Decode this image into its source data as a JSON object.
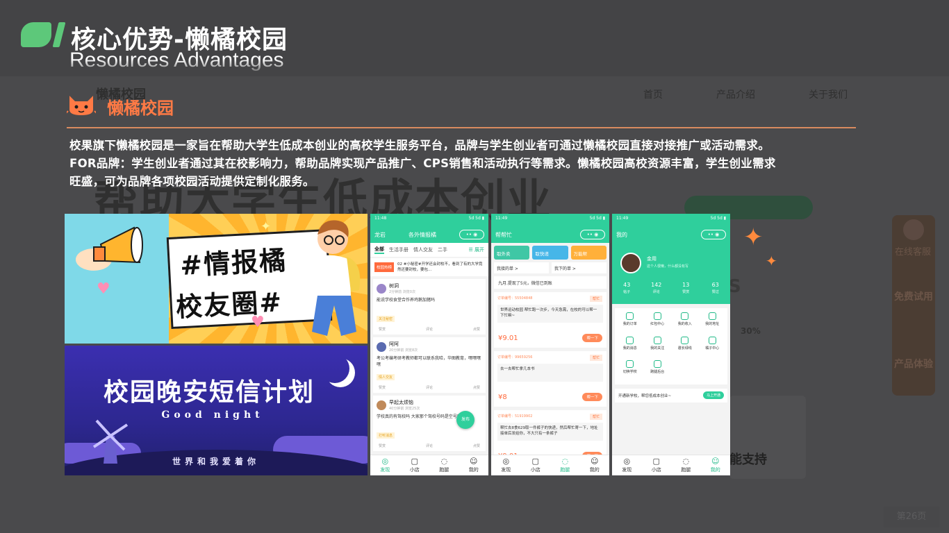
{
  "header": {
    "title_cn": "核心优势-懒橘校园",
    "title_en": "Resources Advantages"
  },
  "background_site": {
    "logo": "懒橘校园",
    "nav": [
      "首页",
      "产品介绍",
      "关于我们"
    ],
    "headline": "帮助大学生低成本创业",
    "side_service": "在线客服",
    "side_items": [
      "免费试用",
      "产品体验"
    ],
    "support_text": "能支持",
    "percent": "30%",
    "letter": "S"
  },
  "brand": {
    "name": "懒橘校园"
  },
  "intro": {
    "line1": "校果旗下懒橘校园是一家旨在帮助大学生低成本创业的高校学生服务平台，品牌与学生创业者可通过懒橘校园直接对接推广或活动需求。",
    "line2": "FOR品牌：学生创业者通过其在校影响力，帮助品牌实现产品推广、CPS销售和活动执行等需求。懒橘校园高校资源丰富，学生创业需求",
    "line3": "旺盛，可为品牌各项校园活动提供定制化服务。"
  },
  "banner1": {
    "line1": "#情报橘",
    "line2": "校友圈#"
  },
  "banner2": {
    "title": "校园晚安短信计划",
    "subtitle": "Good  night",
    "bottom": "世界和我爱着你"
  },
  "phone_feed": {
    "time": "11:48",
    "signal": "5d 5d ▮",
    "location": "龙岩",
    "title": "各外情报橘",
    "tabs": [
      "全部",
      "生活手册",
      "情人交友",
      "二手"
    ],
    "expand": "☰ 展开",
    "news_tag": "校园热榜",
    "news_text": "02 #小秘密#开学还会封校不，看到了有的大学竟然还要封校，要包...",
    "posts": [
      {
        "name": "树洞",
        "sub": "2分钟前  浏览0次",
        "body": "能说学校食堂合作养鸡鹅加猪吗",
        "chip": "关注秘密",
        "acts": [
          "赞赏",
          "评论",
          "点赞"
        ]
      },
      {
        "name": "阿阿",
        "sub": "20分钟前  浏览8次",
        "body": "考公考编考研考教师都可以联系我哈，华图教育，嘿嘿嘿嘿",
        "chip": "情人交友",
        "acts": [
          "赞赏",
          "评论",
          "点赞"
        ]
      },
      {
        "name": "早起太烦恼",
        "sub": "40分钟前  浏览25次",
        "body": "学校真的有驾校吗 大家那个驾校号码是空号啊",
        "chip": "打听消息",
        "acts": [
          "赞赏",
          "评论",
          "点赞"
        ]
      }
    ],
    "fab": "发布",
    "tabbar": [
      "发现",
      "小店",
      "跑腿",
      "我的"
    ]
  },
  "phone_help": {
    "time": "11:49",
    "title": "帮帮忙",
    "quick": [
      "取外卖",
      "取快递",
      "万能帮"
    ],
    "mine": [
      "我接的单 >",
      "我下的单 >"
    ],
    "notice": "九月.提现了5元，微信已到账",
    "orders": [
      {
        "no": "订单编号：55504848",
        "tag": "帮忙",
        "desc": "世界运动校园 帮忙跑一次步，今天急需，在校的可以帮一下忙嘛~",
        "price": "¥9.01",
        "btn": "帮一下"
      },
      {
        "no": "订单编号：99659256",
        "tag": "帮忙",
        "desc": "去一去帮忙拿几本书",
        "price": "¥8",
        "btn": "帮一下"
      },
      {
        "no": "订单编号：51919902",
        "tag": "帮忙",
        "desc": "帮忙去8食629取一件裤子的快递，然后帮忙寄一下，地址接单后发给你，不大只有一条裤子",
        "price": "¥9.01",
        "btn": "帮一下"
      }
    ],
    "tabbar": [
      "发现",
      "小店",
      "跑腿",
      "我的"
    ]
  },
  "phone_me": {
    "time": "11:49",
    "title": "我的",
    "name": "金用",
    "signature": "这个人很懒，什么都没有写",
    "stats": [
      {
        "value": "43",
        "label": "帖子"
      },
      {
        "value": "142",
        "label": "评论"
      },
      {
        "value": "13",
        "label": "赞赏"
      },
      {
        "value": "63",
        "label": "赞过"
      }
    ],
    "grid": [
      "我的订单",
      "红包中心",
      "我的收入",
      "我的地址",
      "我的消息",
      "我的关注",
      "邀长绿线",
      "橘子中心",
      "切换学校",
      "跑腿后台"
    ],
    "open_text": "开通新学校，帮您低成本创业~",
    "open_btn": "马上开通",
    "tabbar": [
      "发现",
      "小店",
      "跑腿",
      "我的"
    ]
  },
  "page_number": "第26页",
  "colors": {
    "accent_green": "#5dc87a",
    "brand_orange": "#ff7a45",
    "app_green": "#2fcf9c",
    "background": "#444446"
  }
}
